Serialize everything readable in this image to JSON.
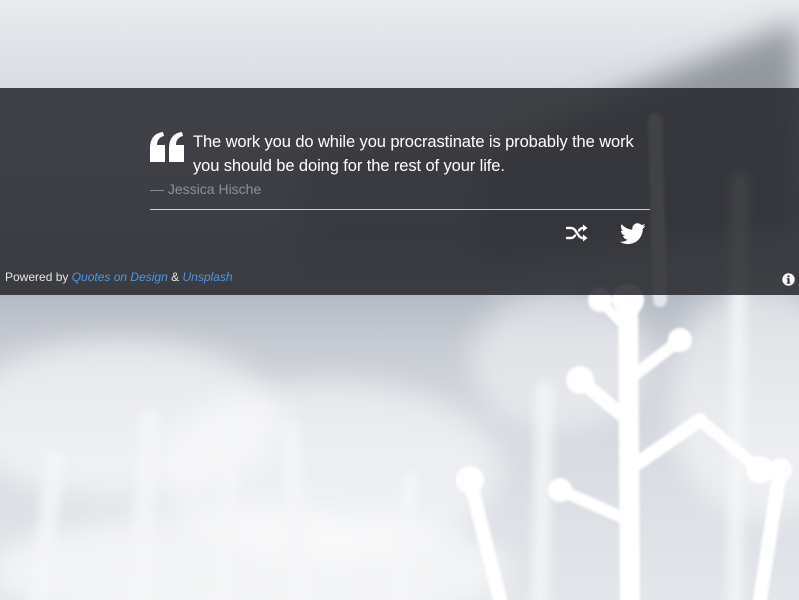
{
  "quote": {
    "text": "The work you do while you procrastinate is probably the work you should be doing for the rest of your life.",
    "author": "— Jessica Hische"
  },
  "actions": {
    "shuffle_icon": "shuffle-icon",
    "twitter_icon": "twitter-icon"
  },
  "footer": {
    "powered_prefix": "Powered by",
    "source1_label": "Quotes on Design",
    "separator": "&",
    "source2_label": "Unsplash",
    "info_icon": "info-icon"
  },
  "colors": {
    "overlay": "#26282c",
    "link": "#4f97e6",
    "author": "#8d9096",
    "text": "#ffffff"
  }
}
